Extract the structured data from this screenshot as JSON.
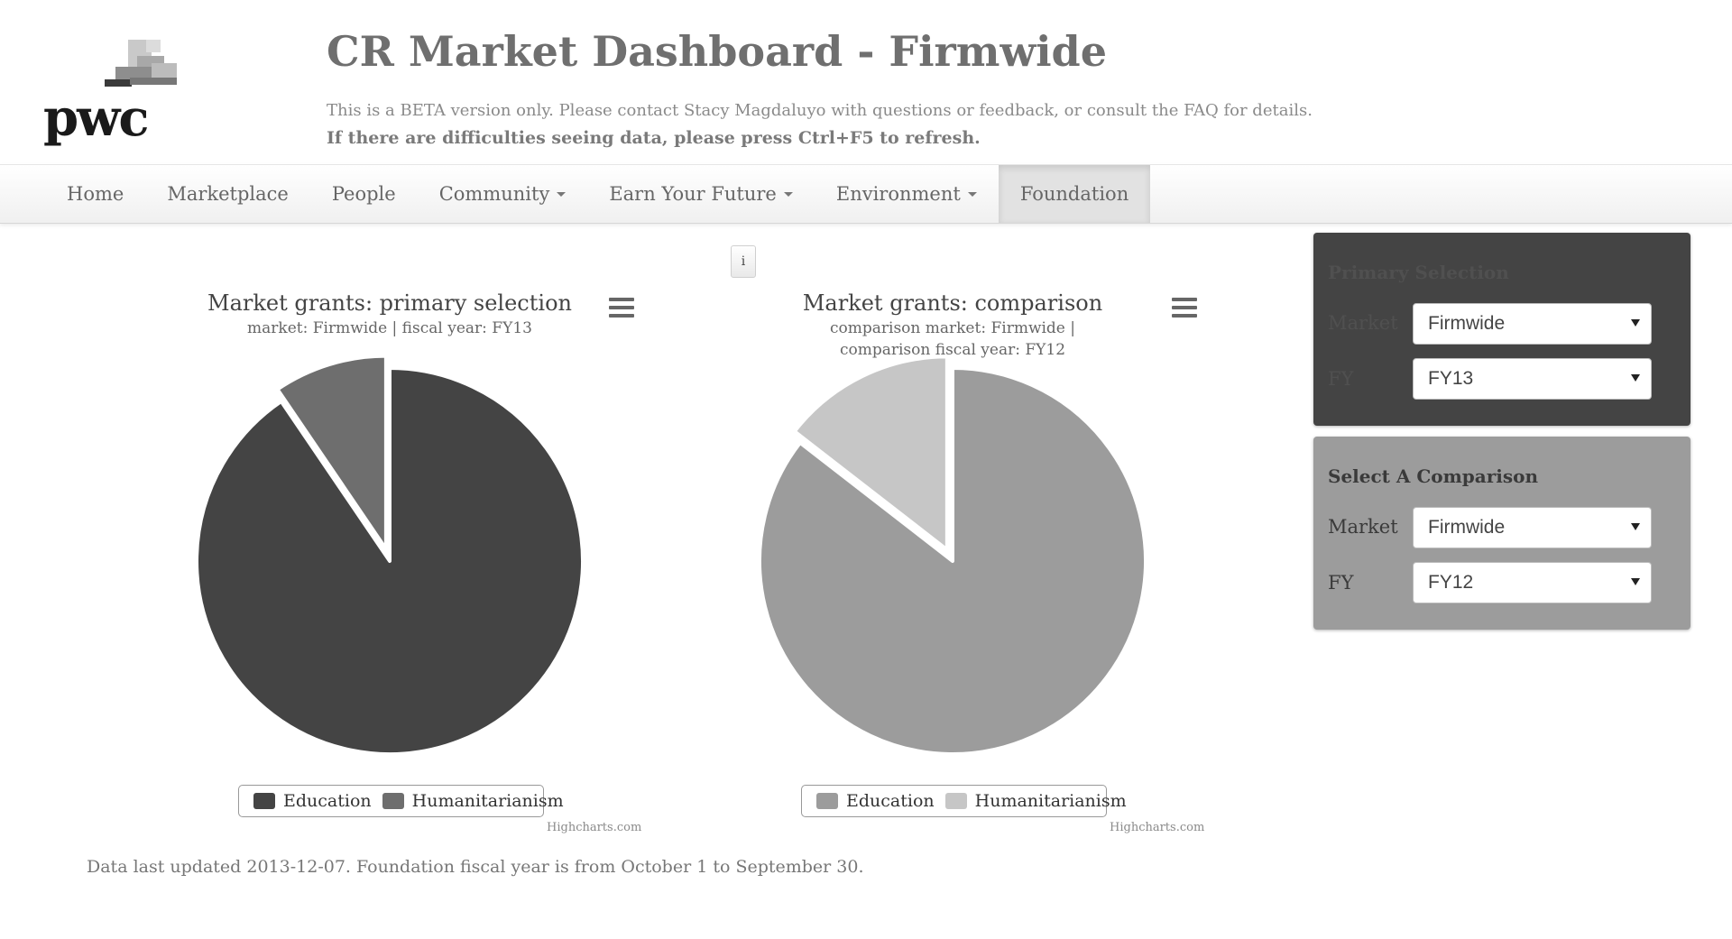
{
  "header": {
    "logo_text": "pwc",
    "title": "CR Market Dashboard - Firmwide",
    "beta_notice": "This is a BETA version only. Please contact Stacy Magdaluyo with questions or feedback, or consult the FAQ for details.",
    "refresh_notice": "If there are difficulties seeing data, please press Ctrl+F5 to refresh."
  },
  "nav": {
    "items": [
      {
        "label": "Home",
        "dropdown": false
      },
      {
        "label": "Marketplace",
        "dropdown": false
      },
      {
        "label": "People",
        "dropdown": false
      },
      {
        "label": "Community",
        "dropdown": true
      },
      {
        "label": "Earn Your Future",
        "dropdown": true
      },
      {
        "label": "Environment",
        "dropdown": true
      },
      {
        "label": "Foundation",
        "dropdown": false,
        "active": true
      }
    ]
  },
  "info_button": {
    "label": "i"
  },
  "charts": [
    {
      "title": "Market grants: primary selection",
      "subtitle": "market: Firmwide | fiscal year: FY13",
      "colors": {
        "Education": "#444444",
        "Humanitarianism": "#6e6e6e"
      },
      "credit": "Highcharts.com"
    },
    {
      "title": "Market grants: comparison",
      "subtitle": "comparison market: Firmwide | comparison fiscal year: FY12",
      "colors": {
        "Education": "#9c9c9c",
        "Humanitarianism": "#c6c6c6"
      },
      "credit": "Highcharts.com"
    }
  ],
  "chart_data": [
    {
      "type": "pie",
      "title": "Market grants: primary selection",
      "subtitle": "market: Firmwide | fiscal year: FY13",
      "categories": [
        "Education",
        "Humanitarianism"
      ],
      "values": [
        90.5,
        9.5
      ],
      "sliced": "Humanitarianism",
      "legend": "bottom-center"
    },
    {
      "type": "pie",
      "title": "Market grants: comparison",
      "subtitle": "comparison market: Firmwide | comparison fiscal year: FY12",
      "categories": [
        "Education",
        "Humanitarianism"
      ],
      "values": [
        85.5,
        14.5
      ],
      "sliced": "Humanitarianism",
      "legend": "bottom-center"
    }
  ],
  "primary_panel": {
    "heading": "Primary Selection",
    "market_label": "Market",
    "market_value": "Firmwide",
    "fy_label": "FY",
    "fy_value": "FY13"
  },
  "compare_panel": {
    "heading": "Select A Comparison",
    "market_label": "Market",
    "market_value": "Firmwide",
    "fy_label": "FY",
    "fy_value": "FY12"
  },
  "footer": {
    "note": "Data last updated 2013-12-07. Foundation fiscal year is from October 1 to September 30."
  }
}
